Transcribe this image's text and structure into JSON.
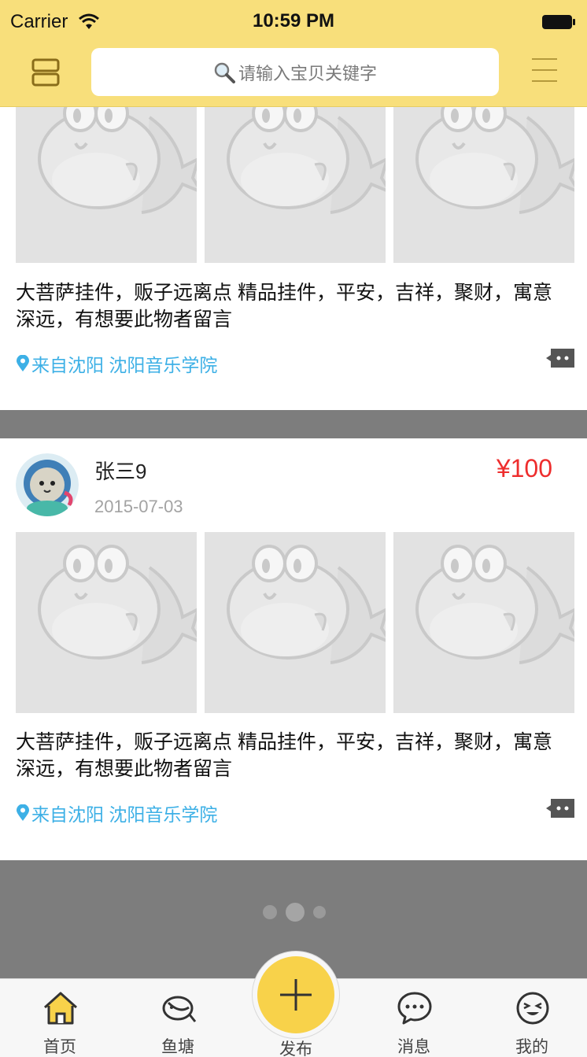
{
  "status_bar": {
    "carrier": "Carrier",
    "time": "10:59 PM"
  },
  "nav": {
    "search_placeholder": "请输入宝贝关键字",
    "left_icon": "list-icon",
    "right_icon": "menu-icon"
  },
  "colors": {
    "brand_yellow": "#f8df7b",
    "accent_yellow": "#f8d24a",
    "price_red": "#ee2d2d",
    "location_blue": "#3db0e6",
    "background_gray": "#7d7d7d"
  },
  "posts": [
    {
      "description": "大菩萨挂件，贩子远离点 精品挂件，平安，吉祥，聚财，寓意深远，有想要此物者留言",
      "location": "来自沈阳 沈阳音乐学院"
    },
    {
      "username": "张三9",
      "date": "2015-07-03",
      "price": "¥100",
      "description": "大菩萨挂件，贩子远离点 精品挂件，平安，吉祥，聚财，寓意深远，有想要此物者留言",
      "location": "来自沈阳 沈阳音乐学院"
    }
  ],
  "tabbar": {
    "home": "首页",
    "pond": "鱼塘",
    "publish": "发布",
    "messages": "消息",
    "mine": "我的"
  }
}
